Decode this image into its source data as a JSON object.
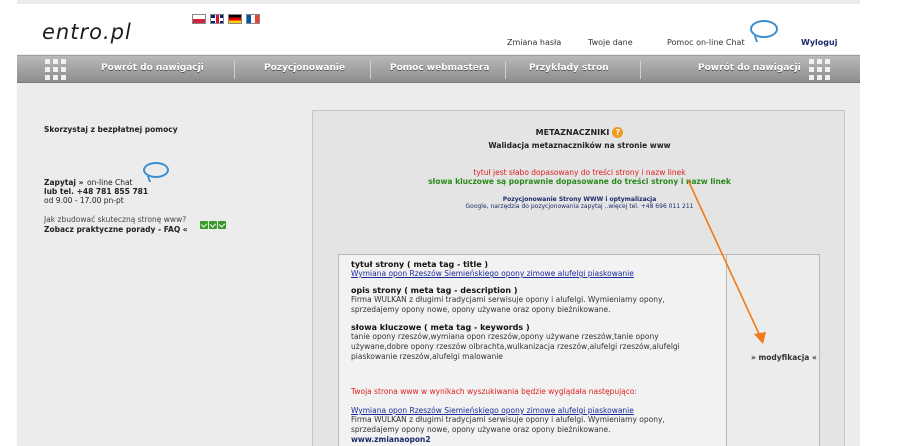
{
  "header": {
    "logo": "entro.pl",
    "links": {
      "change_password": "Zmiana hasła",
      "your_data": "Twoje dane",
      "chat_help": "Pomoc on-line Chat",
      "logout": "Wyloguj"
    }
  },
  "nav": {
    "items": [
      "Powrót do nawigacji",
      "Pozycjonowanie",
      "Pomoc webmastera",
      "Przykłady stron",
      "Powrót do nawigacji"
    ]
  },
  "left": {
    "free_help": "Skorzystaj z bezpłatnej pomocy",
    "ask": "Zapytaj »",
    "online_chat": "on-line Chat",
    "phone": "lub tel. +48 781 855 781",
    "hours": "od 9.00 - 17.00 pn-pt",
    "how_to": "Jak zbudować skuteczną stronę www?",
    "faq": "Zobacz praktyczne porady - FAQ «"
  },
  "panel": {
    "title": "METAZNACZNIKI",
    "subtitle": "Walidacja metaznaczników na stronie www",
    "warning": "tytuł jest słabo dopasowany do treści strony i nazw linek",
    "ok": "słowa kluczowe są poprawnie dopasowane do treści strony i nazw linek",
    "promo_title": "Pozycjonowanie Strony WWW i optymalizacja",
    "promo_sub": "Google, narzędzia do pozycjonowania zapytaj ..więcej tel. +48 696 011 211",
    "title_label": "tytuł strony ( meta tag - title )",
    "title_value": "Wymiana opon Rzeszów Siemieńskiego opony zimowe alufelgi piaskowanie",
    "desc_label": "opis strony ( meta tag - description )",
    "desc_line1": "Firma WULKAN z długimi tradycjami serwisuje opony i alufelgi. Wymieniamy opony,",
    "desc_line2": "sprzedajemy opony nowe, opony używane oraz opony bieżnikowane.",
    "kw_label": "słowa kluczowe ( meta tag - keywords )",
    "kw_line1": "tanie opony rzeszów,wymiana opon rzeszów,opony używane rzeszów,tanie opony",
    "kw_line2": "używane,dobre opony rzeszów olbrachta,wulkanizacja rzeszów,alufelgi rzeszów,alufelgi",
    "kw_line3": "piaskowanie rzeszów,alufelgi malowanie",
    "modify": "» modyfikacja «",
    "search_preview": "Twoja strona www w wynikach wyszukiwania będzie wyglądała następująco:",
    "preview_title": "Wymiana opon Rzeszów Siemieńskiego opony zimowe alufelgi piaskowanie",
    "preview_line1": "Firma WULKAN z długimi tradycjami serwisuje opony i alufelgi. Wymieniamy opony,",
    "preview_line2": "sprzedajemy opony nowe, opony używane oraz opony bieżnikowane.",
    "preview_url": "www.zmianaopon2"
  },
  "colors": {
    "warning": "#e02020",
    "ok": "#2a8a1c",
    "arrow": "#f07a1a"
  }
}
